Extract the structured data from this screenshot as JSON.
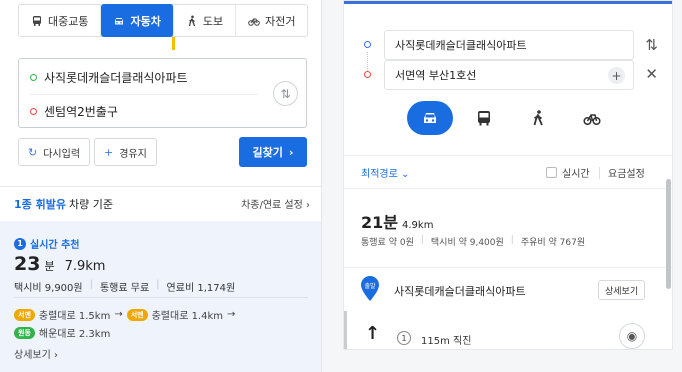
{
  "left": {
    "modes": [
      "대중교통",
      "자동차",
      "도보",
      "자전거"
    ],
    "origin": "사직롯데캐슬더클래식아파트",
    "destination": "센텀역2번출구",
    "reset_label": "다시입력",
    "waypoint_label": "경유지",
    "search_label": "길찾기",
    "basis_highlight": "1종 휘발유",
    "basis_rest": "차량 기준",
    "setting_label": "차종/연료 설정",
    "route": {
      "badge_num": "1",
      "title": "실시간 추천",
      "time_num": "23",
      "time_unit": "분",
      "distance": "7.9km",
      "taxi": "택시비 9,900원",
      "toll": "통행료 무료",
      "fuel": "연료비 1,174원",
      "tag_yellow": "서멘",
      "road1": "충렬대로 1.5km",
      "road2": "충렬대로 1.4km",
      "tag_green": "원동",
      "road3": "해운대로 2.3km",
      "detail": "상세보기"
    }
  },
  "right": {
    "origin": "사직롯데캐슬더클래식아파트",
    "destination": "서면역 부산1호선",
    "best_route": "최적경로",
    "realtime": "실시간",
    "fee_setting": "요금설정",
    "time": "21분",
    "distance": "4.9km",
    "toll": "통행료 약 0원",
    "taxi": "택시비 약 9,400원",
    "fuel": "주유비 약 767원",
    "start_tag": "출발",
    "start_name": "사직롯데캐슬더클래식아파트",
    "detail_btn": "상세보기",
    "step_num": "1",
    "step_text": "115m 직진"
  },
  "colors": {
    "accent": "#1a6de0",
    "origin": "#2fb548",
    "destination": "#ee4a39",
    "card_bg": "#eef3fc"
  }
}
